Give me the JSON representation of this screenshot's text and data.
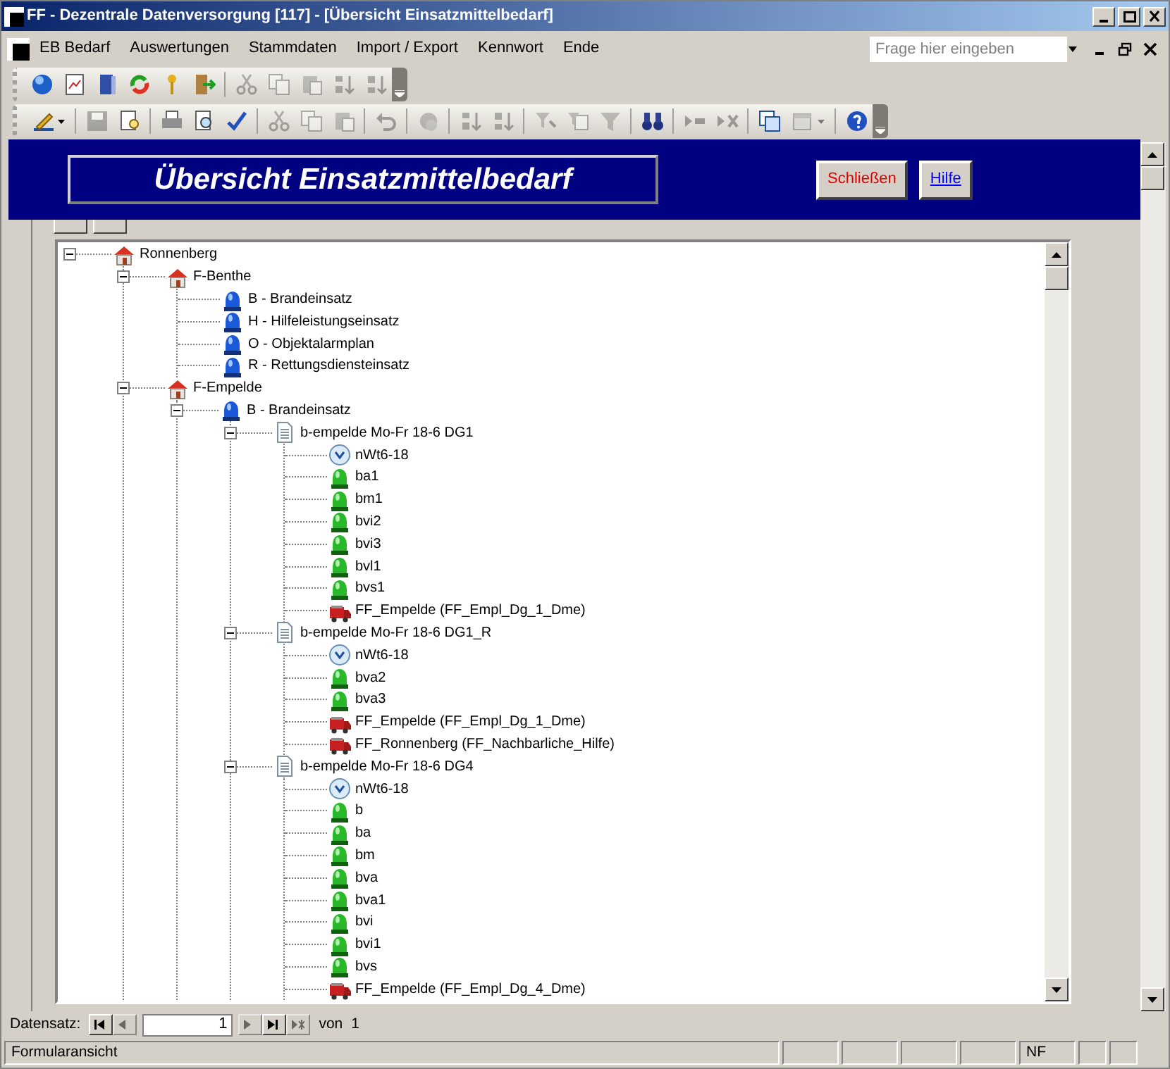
{
  "window": {
    "title": "FF - Dezentrale Datenversorgung [117] - [Übersicht Einsatzmittelbedarf]"
  },
  "menu": [
    "EB Bedarf",
    "Auswertungen",
    "Stammdaten",
    "Import / Export",
    "Kennwort",
    "Ende"
  ],
  "help_search": {
    "placeholder": "Frage hier eingeben"
  },
  "toolbars": [
    {
      "buttons": [
        {
          "kind": "button",
          "disabled": false
        },
        {
          "kind": "button",
          "disabled": false
        },
        {
          "kind": "button",
          "disabled": false
        },
        {
          "kind": "button",
          "disabled": false
        },
        {
          "kind": "button",
          "disabled": false
        },
        {
          "kind": "button",
          "disabled": false
        },
        {
          "kind": "separator"
        },
        {
          "kind": "button",
          "disabled": true
        },
        {
          "kind": "button",
          "disabled": true
        },
        {
          "kind": "button",
          "disabled": true
        },
        {
          "kind": "button",
          "disabled": true
        },
        {
          "kind": "button",
          "disabled": true
        }
      ]
    },
    {
      "buttons": [
        {
          "kind": "dropdown",
          "disabled": false
        },
        {
          "kind": "separator"
        },
        {
          "kind": "button",
          "disabled": true
        },
        {
          "kind": "button",
          "disabled": false
        },
        {
          "kind": "separator"
        },
        {
          "kind": "button",
          "disabled": false
        },
        {
          "kind": "button",
          "disabled": false
        },
        {
          "kind": "button",
          "disabled": false
        },
        {
          "kind": "separator"
        },
        {
          "kind": "button",
          "disabled": true
        },
        {
          "kind": "button",
          "disabled": true
        },
        {
          "kind": "button",
          "disabled": true
        },
        {
          "kind": "separator"
        },
        {
          "kind": "button",
          "disabled": true
        },
        {
          "kind": "separator"
        },
        {
          "kind": "button",
          "disabled": true
        },
        {
          "kind": "separator"
        },
        {
          "kind": "button",
          "disabled": true
        },
        {
          "kind": "button",
          "disabled": true
        },
        {
          "kind": "separator"
        },
        {
          "kind": "button",
          "disabled": true
        },
        {
          "kind": "button",
          "disabled": true
        },
        {
          "kind": "button",
          "disabled": true
        },
        {
          "kind": "separator"
        },
        {
          "kind": "button",
          "disabled": false
        },
        {
          "kind": "separator"
        },
        {
          "kind": "button",
          "disabled": true
        },
        {
          "kind": "button",
          "disabled": true
        },
        {
          "kind": "separator"
        },
        {
          "kind": "button",
          "disabled": false
        },
        {
          "kind": "dropdown",
          "disabled": true
        },
        {
          "kind": "separator"
        },
        {
          "kind": "button",
          "disabled": false
        }
      ]
    }
  ],
  "form": {
    "title": "Übersicht Einsatzmittelbedarf",
    "buttons": [
      {
        "label": "Schließen",
        "kind": "close"
      },
      {
        "label": "Hilfe",
        "kind": "help"
      }
    ]
  },
  "tree": [
    {
      "label": "Ronnenberg",
      "kind": "station",
      "expanded": true,
      "children": [
        {
          "label": "F-Benthe",
          "kind": "station",
          "expanded": true,
          "children": [
            {
              "label": "B - Brandeinsatz",
              "kind": "alarm"
            },
            {
              "label": "H - Hilfeleistungseinsatz",
              "kind": "alarm"
            },
            {
              "label": "O - Objektalarmplan",
              "kind": "alarm"
            },
            {
              "label": "R - Rettungsdiensteinsatz",
              "kind": "alarm"
            }
          ]
        },
        {
          "label": "F-Empelde",
          "kind": "station",
          "expanded": true,
          "children": [
            {
              "label": "B - Brandeinsatz",
              "kind": "alarm",
              "expanded": true,
              "children": [
                {
                  "label": "b-empelde Mo-Fr 18-6 DG1",
                  "kind": "plan",
                  "expanded": true,
                  "children": [
                    {
                      "label": "nWt6-18",
                      "kind": "time"
                    },
                    {
                      "label": "ba1",
                      "kind": "unit"
                    },
                    {
                      "label": "bm1",
                      "kind": "unit"
                    },
                    {
                      "label": "bvi2",
                      "kind": "unit"
                    },
                    {
                      "label": "bvi3",
                      "kind": "unit"
                    },
                    {
                      "label": "bvl1",
                      "kind": "unit"
                    },
                    {
                      "label": "bvs1",
                      "kind": "unit"
                    },
                    {
                      "label": "FF_Empelde (FF_Empl_Dg_1_Dme)",
                      "kind": "vehicle"
                    }
                  ]
                },
                {
                  "label": "b-empelde Mo-Fr 18-6 DG1_R",
                  "kind": "plan",
                  "expanded": true,
                  "children": [
                    {
                      "label": "nWt6-18",
                      "kind": "time"
                    },
                    {
                      "label": "bva2",
                      "kind": "unit"
                    },
                    {
                      "label": "bva3",
                      "kind": "unit"
                    },
                    {
                      "label": "FF_Empelde (FF_Empl_Dg_1_Dme)",
                      "kind": "vehicle"
                    },
                    {
                      "label": "FF_Ronnenberg (FF_Nachbarliche_Hilfe)",
                      "kind": "vehicle"
                    }
                  ]
                },
                {
                  "label": "b-empelde Mo-Fr 18-6 DG4",
                  "kind": "plan",
                  "expanded": true,
                  "children": [
                    {
                      "label": "nWt6-18",
                      "kind": "time"
                    },
                    {
                      "label": "b",
                      "kind": "unit"
                    },
                    {
                      "label": "ba",
                      "kind": "unit"
                    },
                    {
                      "label": "bm",
                      "kind": "unit"
                    },
                    {
                      "label": "bva",
                      "kind": "unit"
                    },
                    {
                      "label": "bva1",
                      "kind": "unit"
                    },
                    {
                      "label": "bvi",
                      "kind": "unit"
                    },
                    {
                      "label": "bvi1",
                      "kind": "unit"
                    },
                    {
                      "label": "bvs",
                      "kind": "unit"
                    },
                    {
                      "label": "FF_Empelde (FF_Empl_Dg_4_Dme)",
                      "kind": "vehicle"
                    }
                  ]
                }
              ]
            }
          ]
        }
      ]
    }
  ],
  "record_navigator": {
    "label": "Datensatz:",
    "value": "1",
    "of_label": "von",
    "total": "1",
    "buttons": [
      {
        "disabled": false
      },
      {
        "disabled": true
      },
      {
        "disabled": true
      },
      {
        "disabled": false
      },
      {
        "disabled": true
      }
    ]
  },
  "status_bar": {
    "text": "Formularansicht",
    "indicators": [
      "NF"
    ]
  }
}
